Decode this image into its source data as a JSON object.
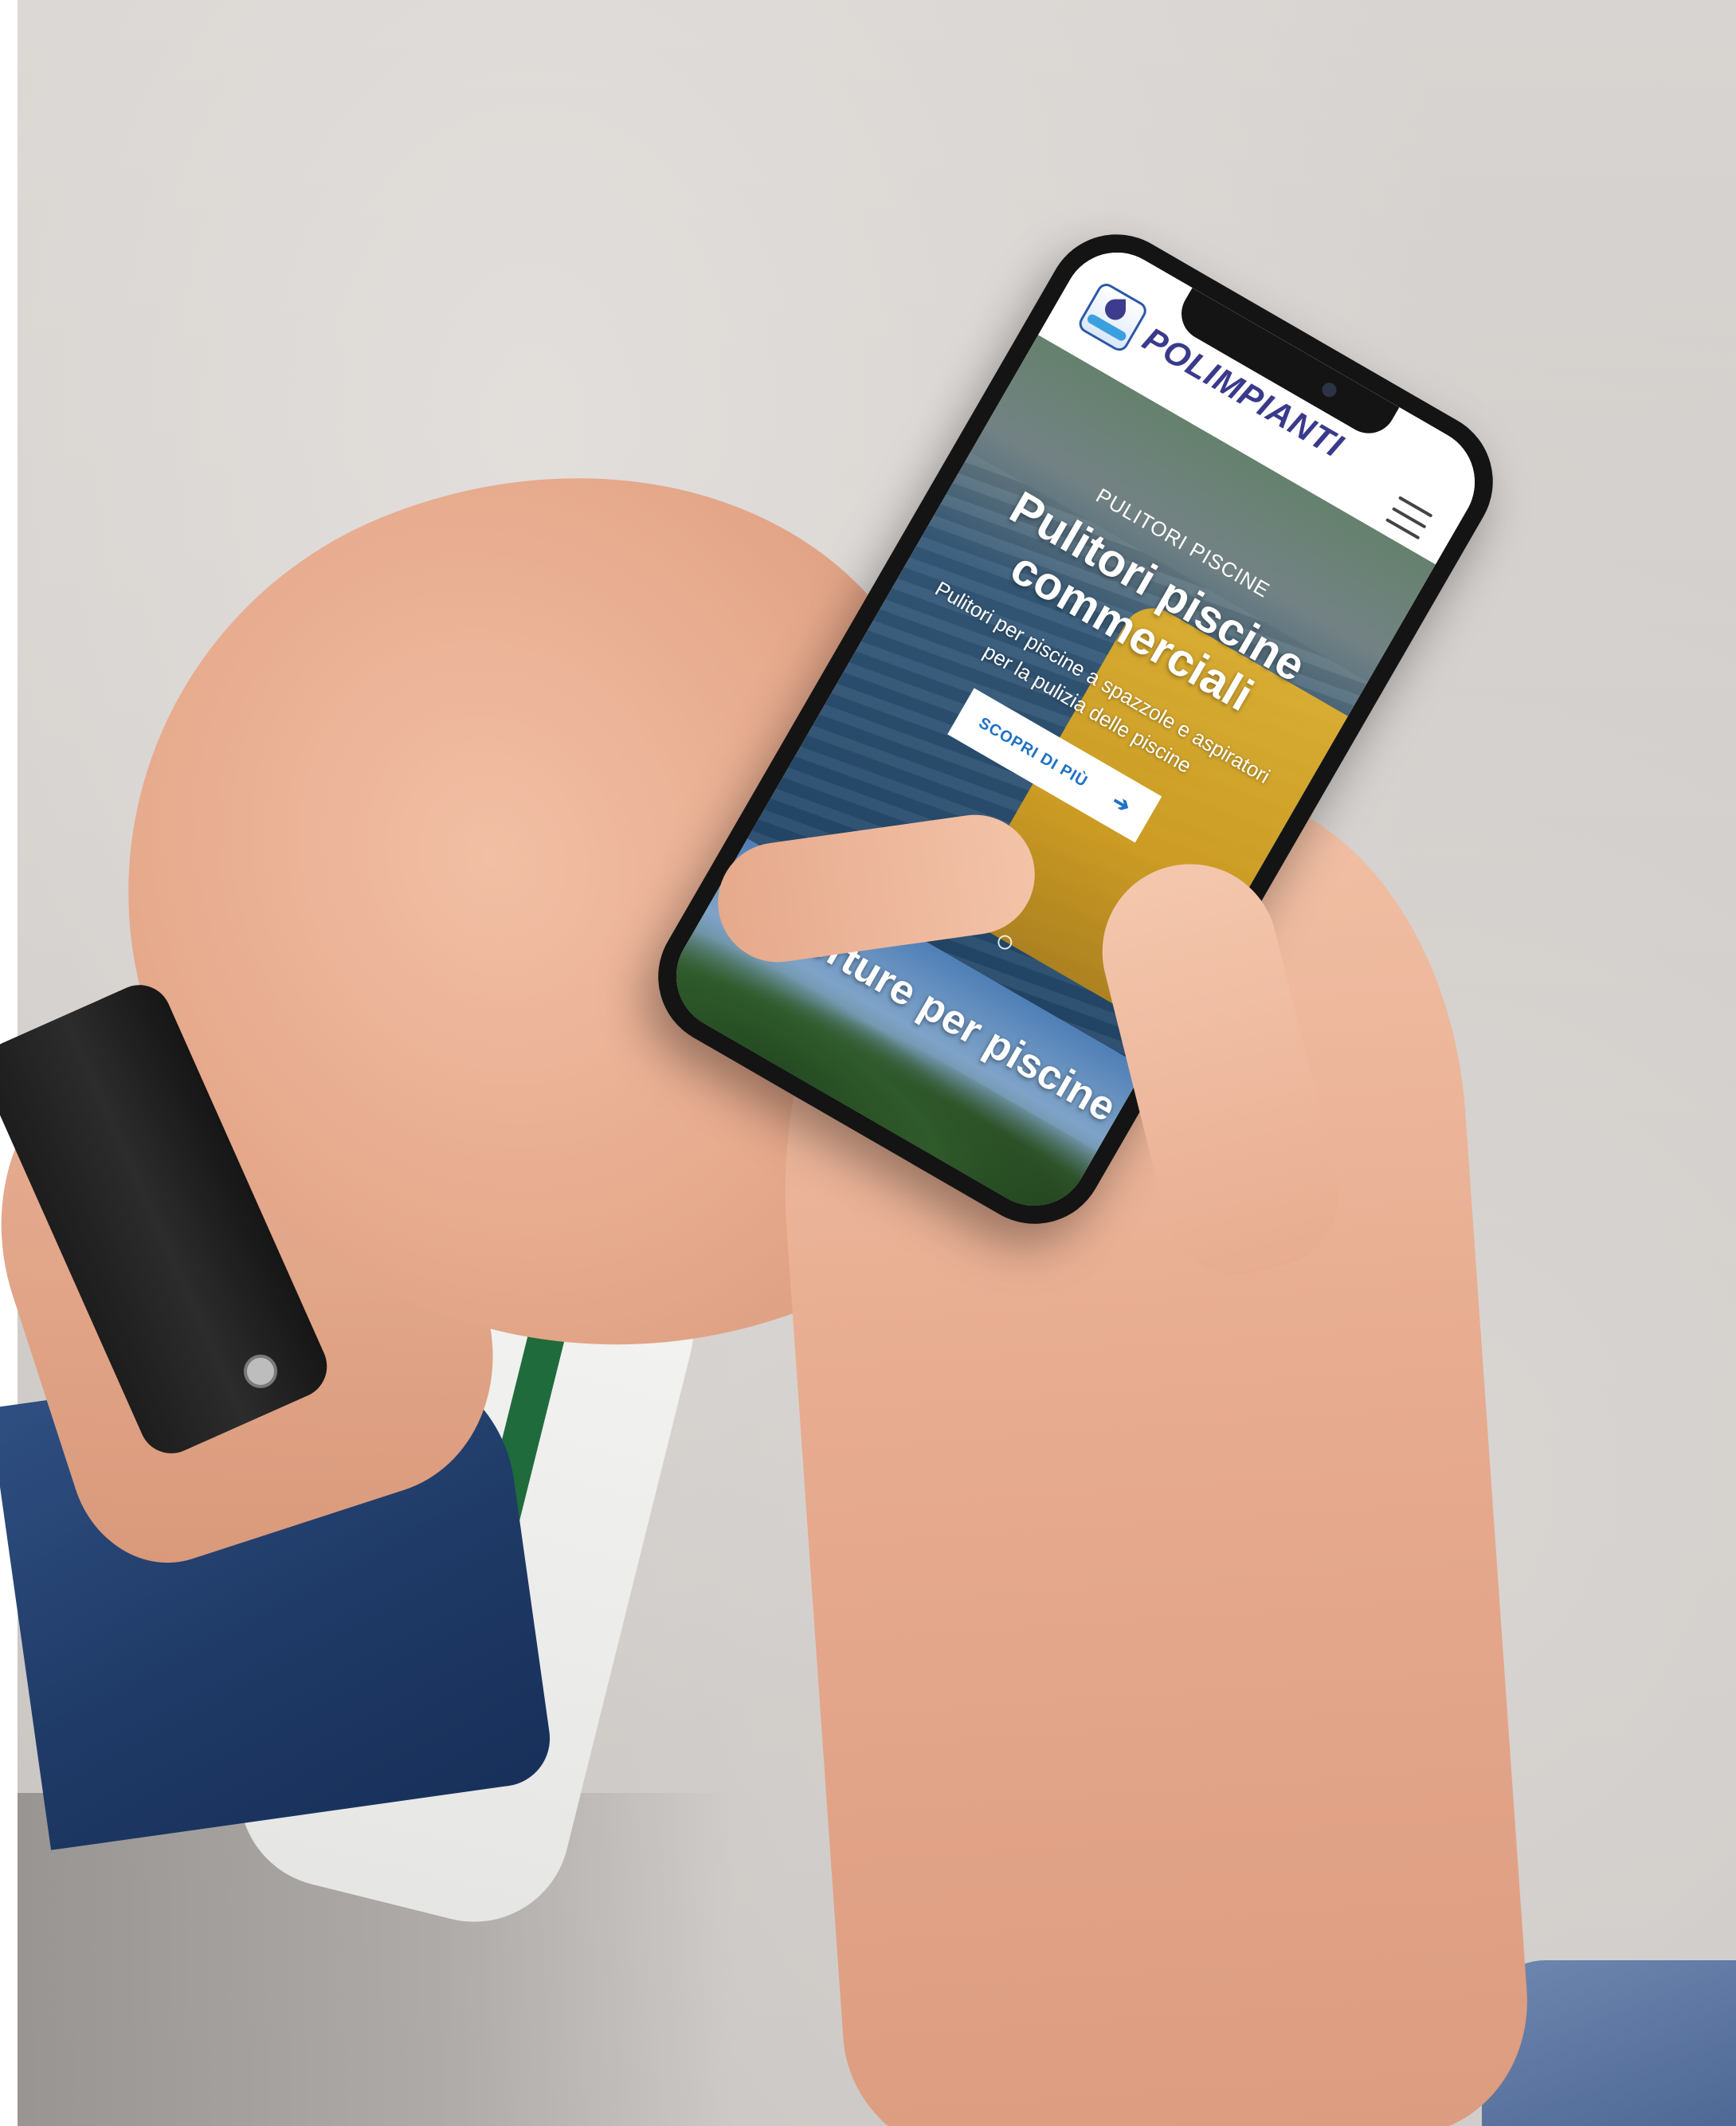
{
  "site": {
    "brand": "POLIMPIANTI",
    "logo_icon": "polimpianti-logo-icon",
    "menu_icon": "hamburger-menu-icon"
  },
  "hero": {
    "eyebrow": "PULITORI PISCINE",
    "title": "Pulitori piscine commerciali",
    "subtitle": "Pulitori per piscine a spazzole e aspiratori per la pulizia delle piscine",
    "cta_label": "SCOPRI DI PIÙ",
    "cta_icon": "arrow-right-icon",
    "slides_total": 4,
    "active_slide": 1
  },
  "next_slide": {
    "title": "Coperture per piscine"
  },
  "colors": {
    "brand_text": "#3a3a8c",
    "cta_text": "#1f72c4",
    "header_bg": "#ffffff"
  }
}
